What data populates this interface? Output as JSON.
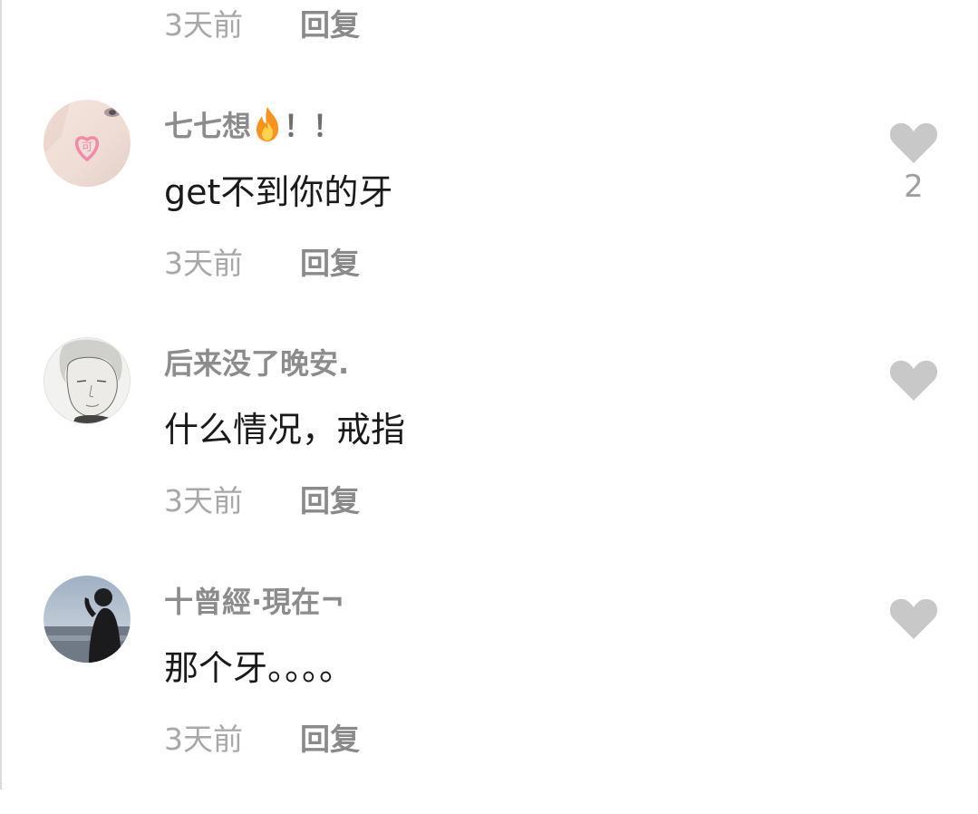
{
  "top_meta": {
    "time": "3天前",
    "reply": "回复"
  },
  "comments": [
    {
      "username": "七七想",
      "username_suffix": "！！",
      "username_emoji": "fire-icon",
      "text": "get不到你的牙",
      "time": "3天前",
      "reply": "回复",
      "likes": "2",
      "avatar": "heart-sticker-avatar"
    },
    {
      "username": "后来没了晚安.",
      "username_suffix": "",
      "username_emoji": "",
      "text": "什么情况，戒指",
      "time": "3天前",
      "reply": "回复",
      "likes": "",
      "avatar": "sketch-portrait-avatar"
    },
    {
      "username": "十曾經·現在",
      "username_suffix": "¬",
      "username_emoji": "",
      "text": "那个牙。。。。",
      "time": "3天前",
      "reply": "回复",
      "likes": "",
      "avatar": "seaside-silhouette-avatar"
    }
  ],
  "colors": {
    "username": "#8c8c8c",
    "text": "#1a1a1a",
    "time": "#a8a8a8",
    "like_icon": "#c8c8c8"
  }
}
